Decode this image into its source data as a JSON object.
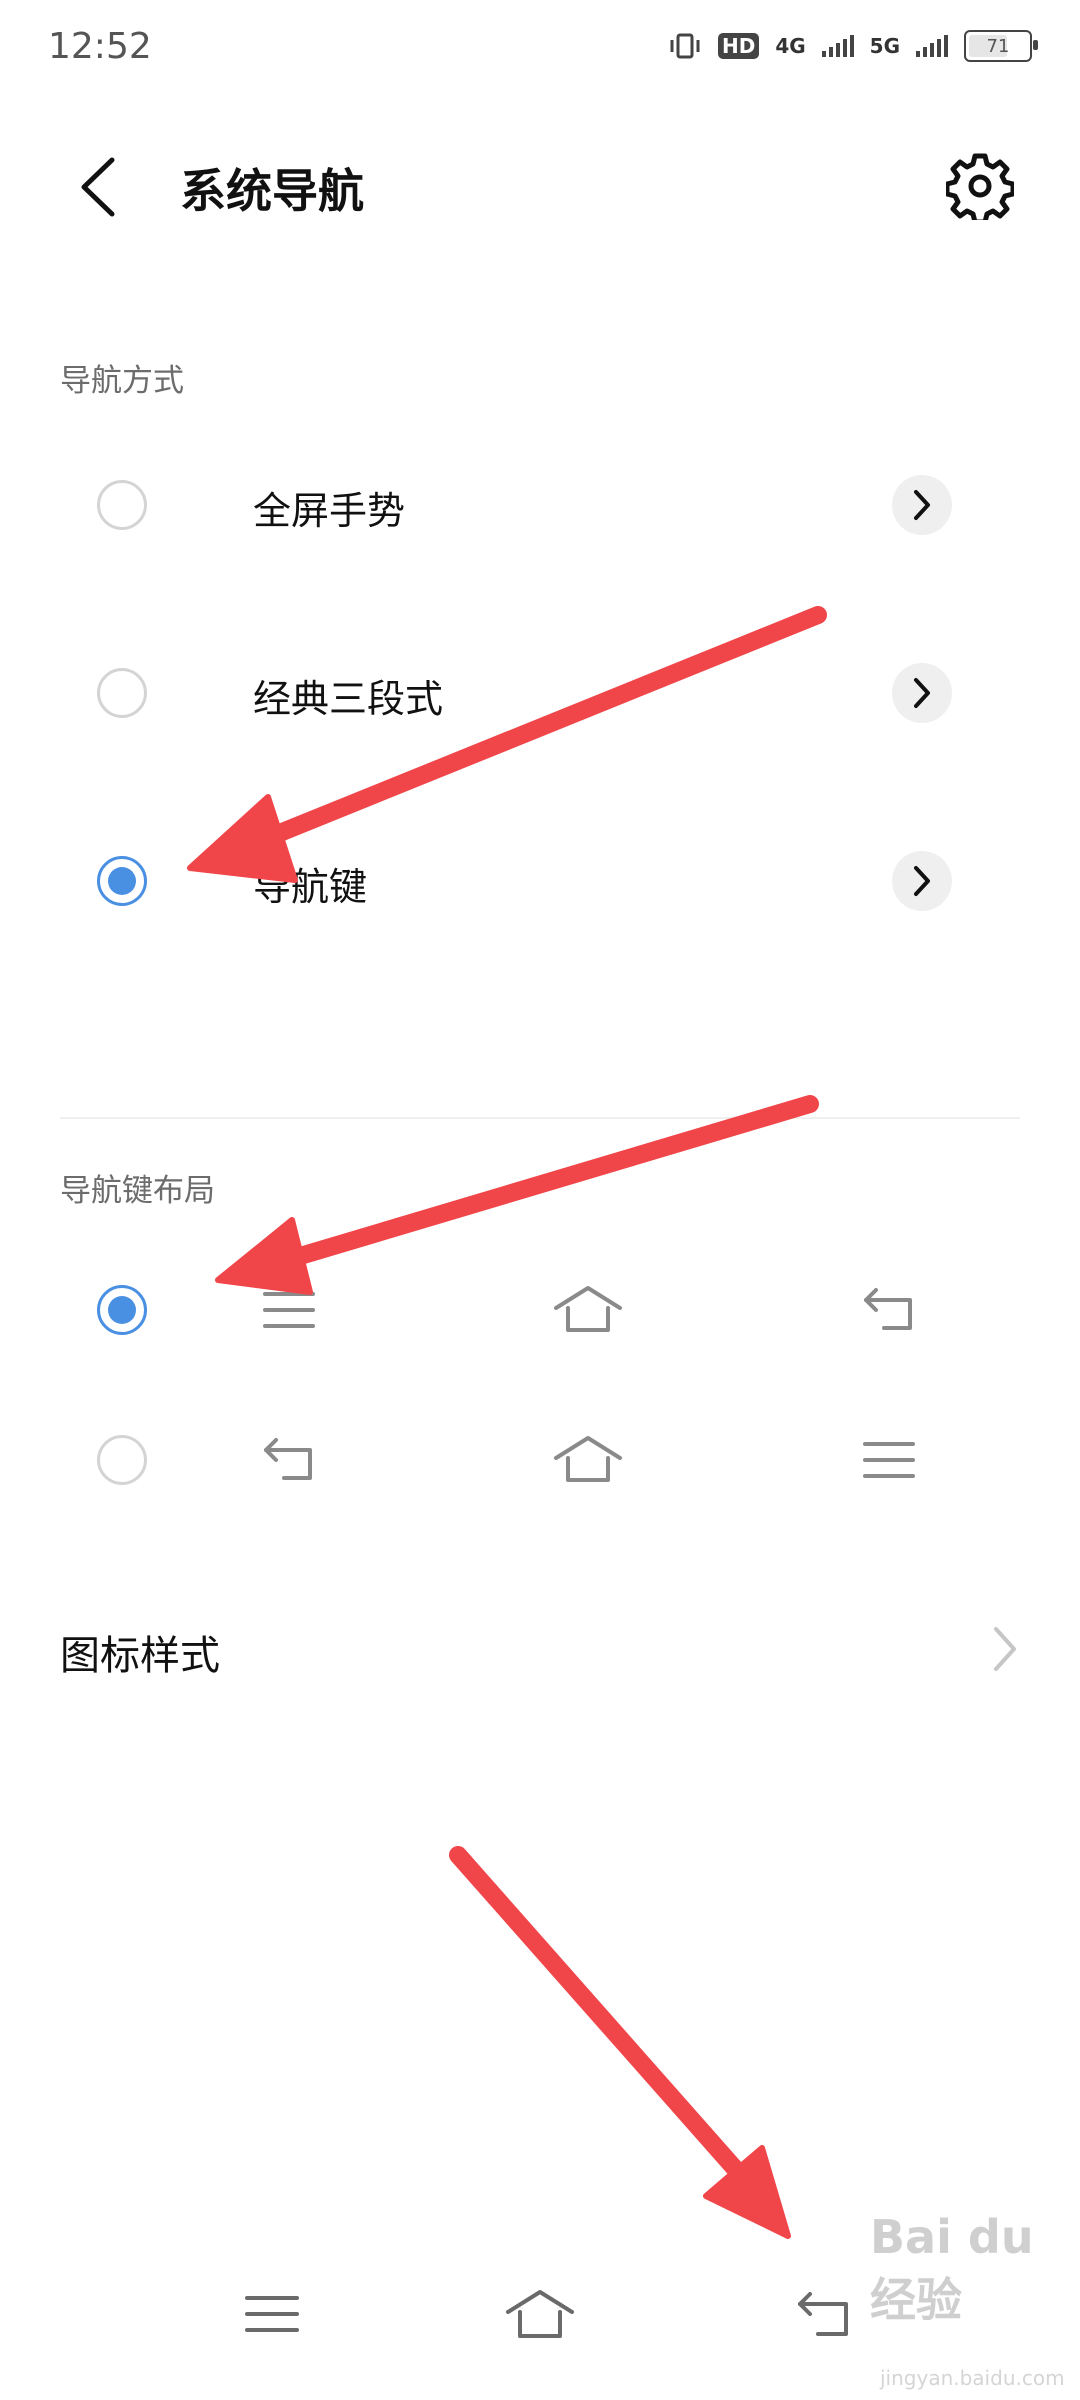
{
  "status_bar": {
    "time": "12:52",
    "hd": "HD",
    "net1": "4G",
    "net2": "5G",
    "battery": "71",
    "battery_level": 0.71
  },
  "header": {
    "title": "系统导航"
  },
  "nav_mode": {
    "section_title": "导航方式",
    "options": [
      {
        "label": "全屏手势",
        "selected": false
      },
      {
        "label": "经典三段式",
        "selected": false
      },
      {
        "label": "导航键",
        "selected": true
      }
    ]
  },
  "nav_layout": {
    "section_title": "导航键布局",
    "options": [
      {
        "order": [
          "menu-icon",
          "home-icon",
          "back-icon"
        ],
        "selected": true
      },
      {
        "order": [
          "back-icon",
          "home-icon",
          "menu-icon"
        ],
        "selected": false
      }
    ]
  },
  "icon_style": {
    "label": "图标样式"
  },
  "system_nav_bar": {
    "icons": [
      "menu-icon",
      "home-icon",
      "back-icon"
    ]
  },
  "watermark": {
    "text": "Bai du 经验",
    "sub": "jingyan.baidu.com"
  },
  "colors": {
    "accent": "#4a90e2",
    "annotation_arrow": "#f0464a"
  }
}
